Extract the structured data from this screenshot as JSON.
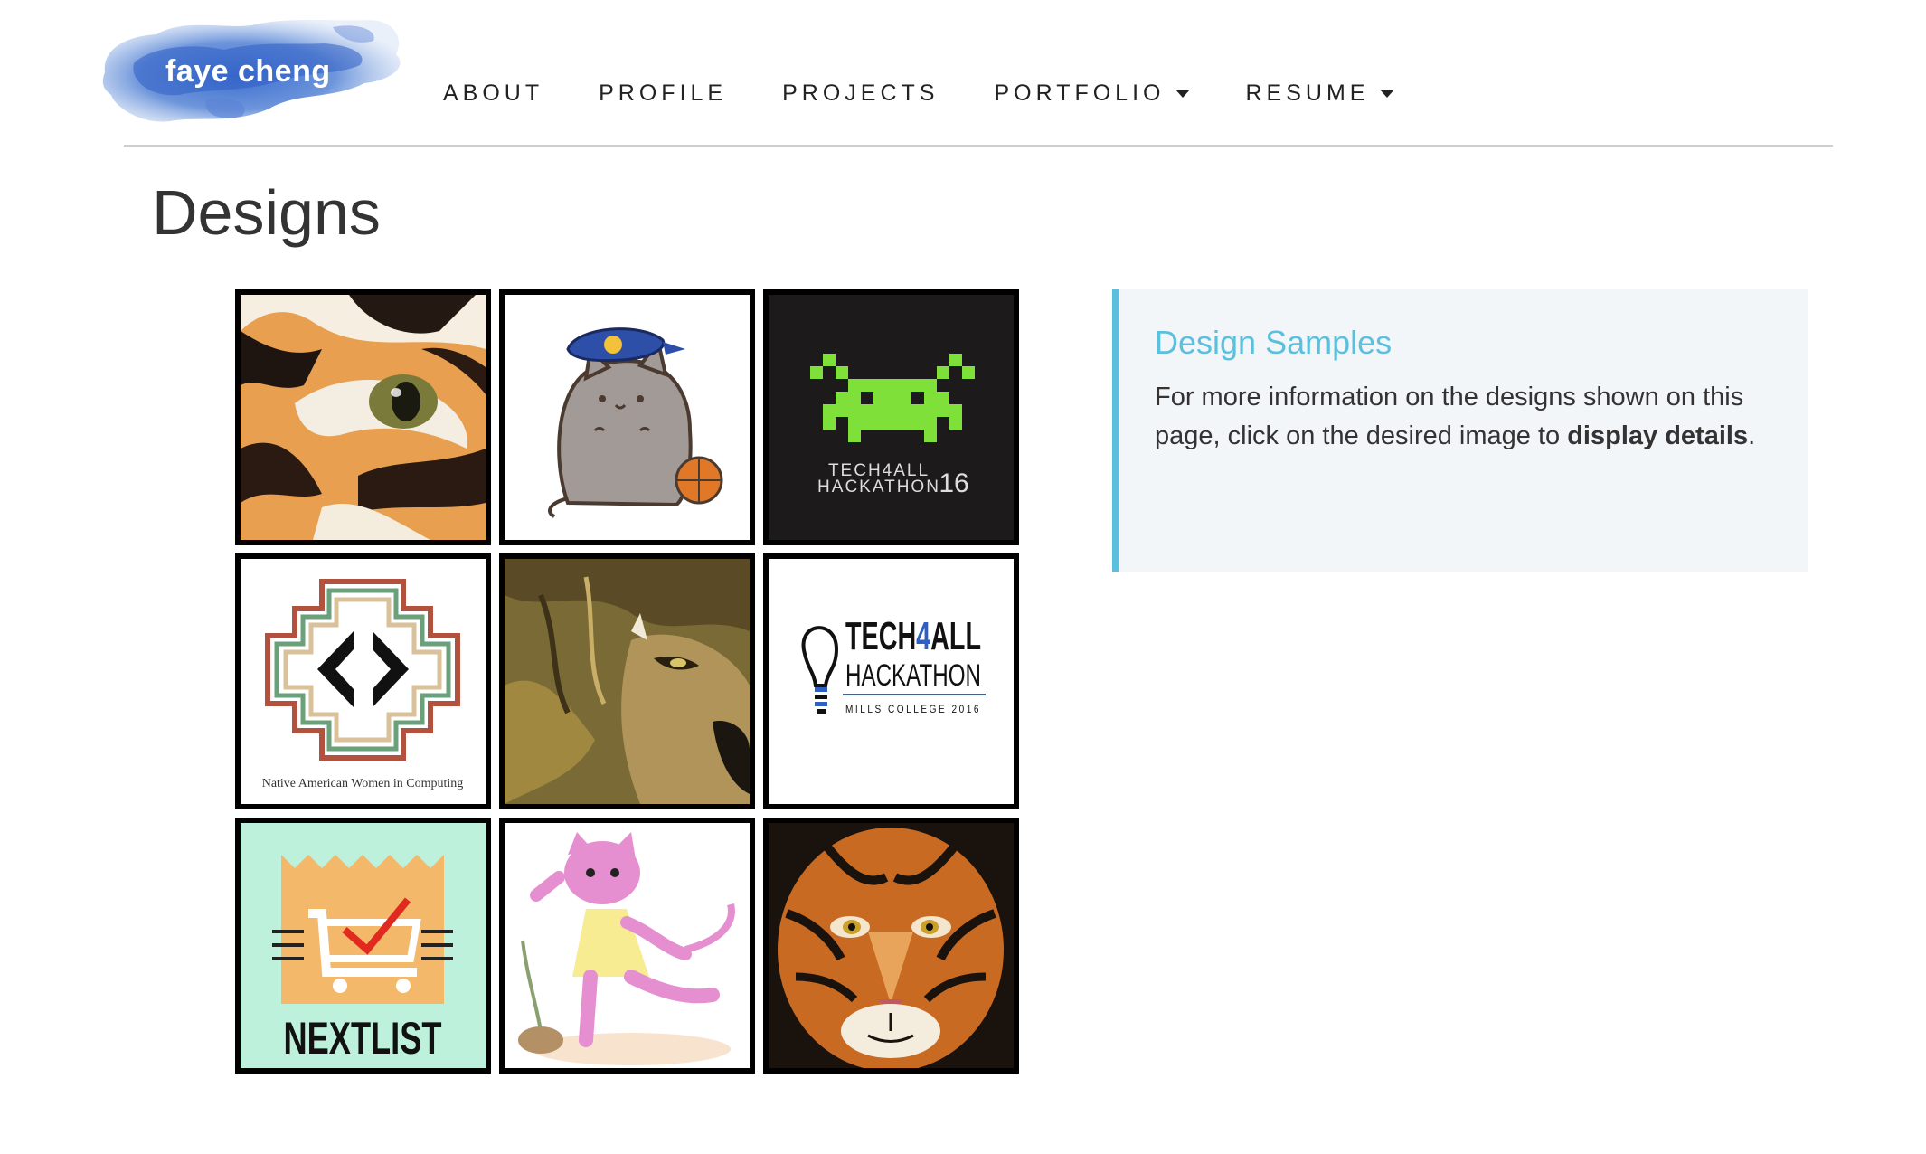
{
  "header": {
    "logo_text": "faye cheng",
    "nav": [
      {
        "label": "ABOUT",
        "dropdown": false
      },
      {
        "label": "PROFILE",
        "dropdown": false
      },
      {
        "label": "PROJECTS",
        "dropdown": false
      },
      {
        "label": "PORTFOLIO",
        "dropdown": true
      },
      {
        "label": "RESUME",
        "dropdown": true
      }
    ]
  },
  "main": {
    "title": "Designs",
    "tiles": [
      {
        "name": "tiger-eye"
      },
      {
        "name": "pusheen-cat-basketball"
      },
      {
        "name": "tech4all-hackathon-16-tshirt",
        "line1": "TECH4ALL",
        "line2": "HACKATHON",
        "year": "16"
      },
      {
        "name": "native-american-women-in-computing",
        "caption": "Native American Women in Computing"
      },
      {
        "name": "lion-drawing"
      },
      {
        "name": "tech4all-hackathon-logo",
        "line1a": "TECH",
        "line1b": "4",
        "line1c": "ALL",
        "line2": "HACKATHON",
        "line3": "MILLS COLLEGE 2016"
      },
      {
        "name": "nextlist-logo",
        "caption": "NEXTLIST"
      },
      {
        "name": "pink-cat-dancing"
      },
      {
        "name": "tiger-face"
      }
    ]
  },
  "info_panel": {
    "title": "Design Samples",
    "text_before": "For more information on the designs shown on this page, click on the desired image to ",
    "text_bold": "display details",
    "text_after": "."
  },
  "colors": {
    "accent": "#5bc0de",
    "panel_bg": "#f3f6f8",
    "text": "#333333"
  }
}
